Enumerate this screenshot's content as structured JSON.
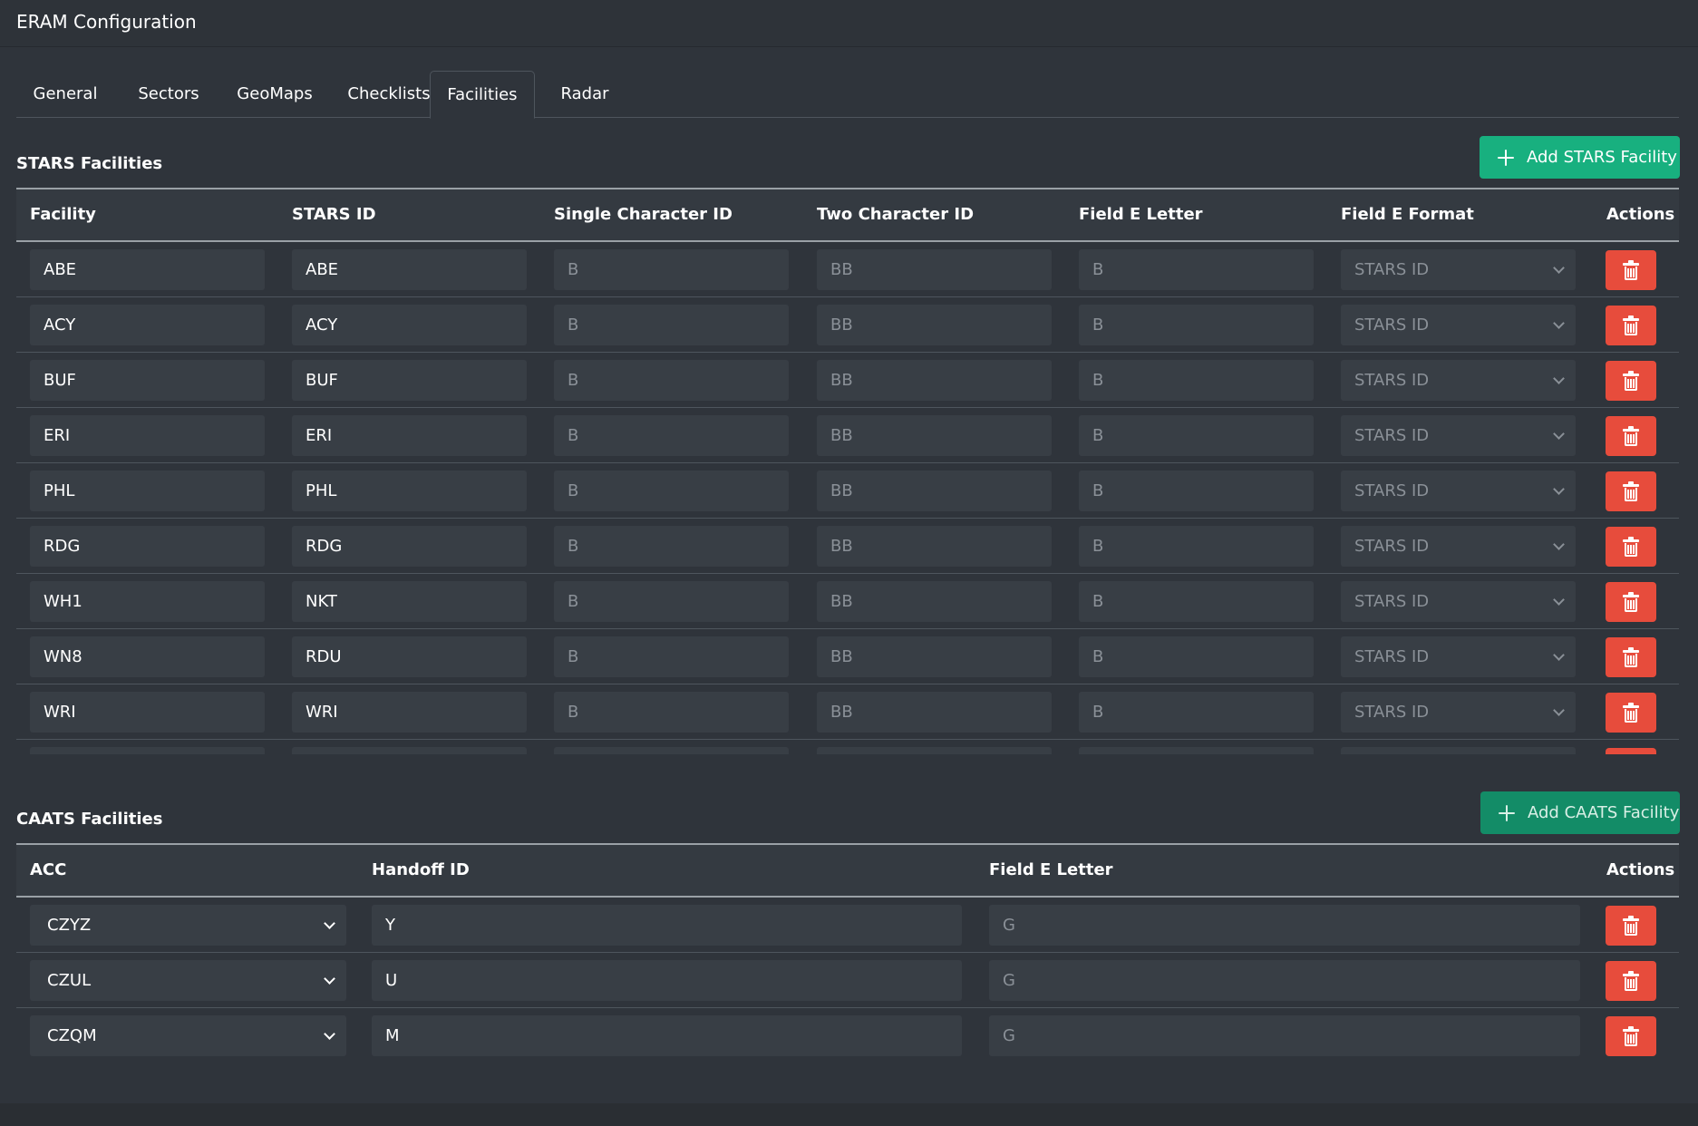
{
  "app": {
    "title": "ERAM Configuration"
  },
  "tabs": [
    {
      "label": "General",
      "active": false
    },
    {
      "label": "Sectors",
      "active": false
    },
    {
      "label": "GeoMaps",
      "active": false
    },
    {
      "label": "Checklists",
      "active": false
    },
    {
      "label": "Facilities",
      "active": true
    },
    {
      "label": "Radar",
      "active": false
    }
  ],
  "stars": {
    "title": "STARS Facilities",
    "add_label": "Add STARS Facility",
    "columns": [
      "Facility",
      "STARS ID",
      "Single Character ID",
      "Two Character ID",
      "Field E Letter",
      "Field E Format",
      "Actions"
    ],
    "placeholders": {
      "single": "B",
      "two": "BB",
      "field_e_letter": "B",
      "field_e_format": "STARS ID"
    },
    "rows": [
      {
        "facility": "ABE",
        "stars_id": "ABE"
      },
      {
        "facility": "ACY",
        "stars_id": "ACY"
      },
      {
        "facility": "BUF",
        "stars_id": "BUF"
      },
      {
        "facility": "ERI",
        "stars_id": "ERI"
      },
      {
        "facility": "PHL",
        "stars_id": "PHL"
      },
      {
        "facility": "RDG",
        "stars_id": "RDG"
      },
      {
        "facility": "WH1",
        "stars_id": "NKT"
      },
      {
        "facility": "WN8",
        "stars_id": "RDU"
      },
      {
        "facility": "WRI",
        "stars_id": "WRI"
      }
    ]
  },
  "caats": {
    "title": "CAATS Facilities",
    "add_label": "Add CAATS Facility",
    "columns": [
      "ACC",
      "Handoff ID",
      "Field E Letter",
      "Actions"
    ],
    "placeholders": {
      "field_e_letter": "G"
    },
    "rows": [
      {
        "acc": "CZYZ",
        "handoff_id": "Y"
      },
      {
        "acc": "CZUL",
        "handoff_id": "U"
      },
      {
        "acc": "CZQM",
        "handoff_id": "M"
      }
    ]
  },
  "colors": {
    "add": "#18b07f",
    "delete": "#e74c3c",
    "background": "#2f343b"
  },
  "icons": {
    "add": "plus-icon",
    "delete": "trash-icon",
    "select": "chevron-down-icon"
  }
}
